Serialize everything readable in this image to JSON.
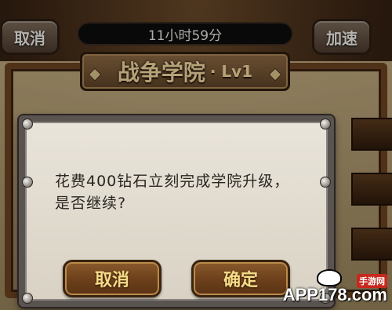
{
  "header": {
    "cancel_label": "取消",
    "timer_text": "11小时59分",
    "speedup_label": "加速",
    "title": "战争学院",
    "level": "· Lv1"
  },
  "dialog": {
    "message": "花费400钻石立刻完成学院升级，是否继续?",
    "cancel_label": "取消",
    "confirm_label": "确定"
  },
  "watermark": {
    "text": "APP178.com",
    "subtext": "手游网"
  }
}
